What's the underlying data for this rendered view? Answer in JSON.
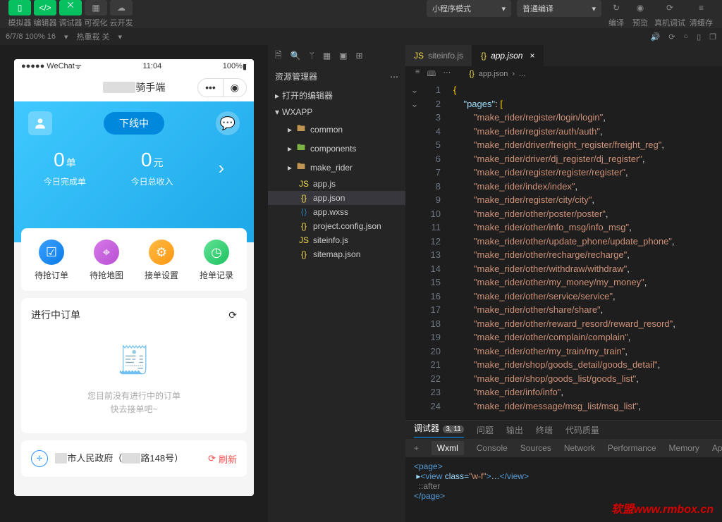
{
  "toolbar": {
    "simulator": "模拟器",
    "editor": "编辑器",
    "debugger": "调试器",
    "visualize": "可视化",
    "cloud": "云开发",
    "mode": "小程序模式",
    "compile": "普通编译",
    "compileBtn": "编译",
    "preview": "预览",
    "realDevice": "真机调试",
    "clearCache": "清缓存"
  },
  "secondBar": {
    "devices": "6/7/8 100% 16",
    "hotReload": "热重载 关"
  },
  "phone": {
    "carrier": "WeChat",
    "time": "11:04",
    "battery": "100%",
    "title": "骑手端",
    "heroStatus": "下线中",
    "stat1Num": "0",
    "stat1Unit": "单",
    "stat1Label": "今日完成单",
    "stat2Num": "0",
    "stat2Unit": "元",
    "stat2Label": "今日总收入",
    "tile1": "待抢订单",
    "tile2": "待抢地图",
    "tile3": "接单设置",
    "tile4": "抢单记录",
    "progressTitle": "进行中订单",
    "noOrderLine1": "您目前没有进行中的订单",
    "noOrderLine2": "快去接单吧~",
    "location": "市人民政府（",
    "location2": "路148号）",
    "refresh": "刷新"
  },
  "explorer": {
    "title": "资源管理器",
    "openEditors": "打开的编辑器",
    "workspace": "WXAPP",
    "folders": {
      "common": "common",
      "components": "components",
      "make_rider": "make_rider"
    },
    "files": {
      "appJs": "app.js",
      "appJson": "app.json",
      "appWxss": "app.wxss",
      "projectConfig": "project.config.json",
      "siteinfo": "siteinfo.js",
      "sitemap": "sitemap.json"
    }
  },
  "tabs": {
    "siteinfo": "siteinfo.js",
    "appJson": "app.json"
  },
  "breadcrumb": {
    "file": "app.json",
    "ellipsis": "..."
  },
  "code": {
    "pagesKey": "pages",
    "lines": [
      "make_rider/register/login/login",
      "make_rider/register/auth/auth",
      "make_rider/driver/freight_register/freight_reg",
      "make_rider/driver/dj_register/dj_register",
      "make_rider/register/register/register",
      "make_rider/index/index",
      "make_rider/register/city/city",
      "make_rider/other/poster/poster",
      "make_rider/other/info_msg/info_msg",
      "make_rider/other/update_phone/update_phone",
      "make_rider/other/recharge/recharge",
      "make_rider/other/withdraw/withdraw",
      "make_rider/other/my_money/my_money",
      "make_rider/other/service/service",
      "make_rider/other/share/share",
      "make_rider/other/reward_resord/reward_resord",
      "make_rider/other/complain/complain",
      "make_rider/other/my_train/my_train",
      "make_rider/shop/goods_detail/goods_detail",
      "make_rider/shop/goods_list/goods_list",
      "make_rider/info/info",
      "make_rider/message/msg_list/msg_list"
    ]
  },
  "debugger": {
    "label": "调试器",
    "badge": "3, 11",
    "problems": "问题",
    "output": "输出",
    "terminal": "终端",
    "codeQuality": "代码质量",
    "wxml": "Wxml",
    "console": "Console",
    "sources": "Sources",
    "network": "Network",
    "performance": "Performance",
    "memory": "Memory",
    "appData": "AppD"
  },
  "watermark": "软盟www.rmbox.cn"
}
